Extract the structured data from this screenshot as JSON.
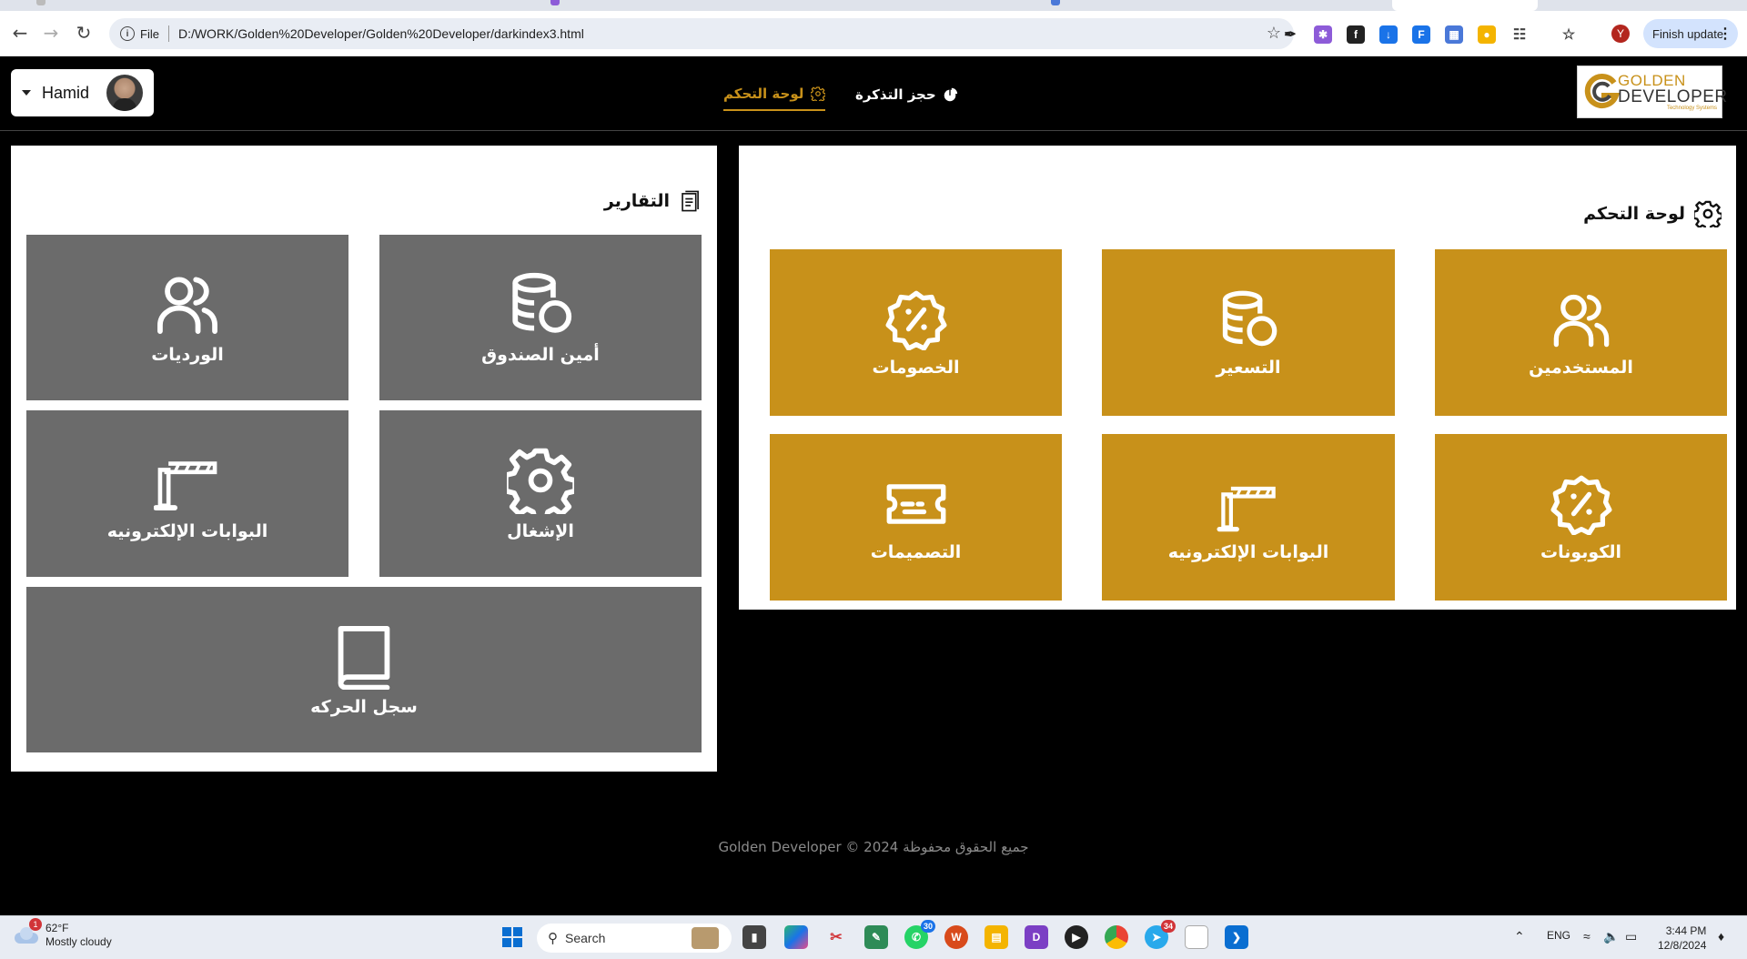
{
  "browser": {
    "address_scheme": "File",
    "address_url": "D:/WORK/Golden%20Developer/Golden%20Developer/darkindex3.html",
    "finish_update_label": "Finish update",
    "profile_initial": "Y"
  },
  "nav": {
    "user_name": "Hamid",
    "links": [
      {
        "label": "لوحة التحكم",
        "icon": "gear-icon",
        "active": true
      },
      {
        "label": "حجز التذكرة",
        "icon": "pie-icon",
        "active": false
      }
    ],
    "logo": {
      "line1": "GOLDEN",
      "line2": "DEVELOPER",
      "tagline": "Technology Systems"
    }
  },
  "dashboard_panel": {
    "title": "لوحة التحكم",
    "title_icon": "gear-icon",
    "tiles": [
      {
        "label": "المستخدمين",
        "icon": "users-icon"
      },
      {
        "label": "التسعير",
        "icon": "coins-icon"
      },
      {
        "label": "الخصومات",
        "icon": "discount-badge-icon"
      },
      {
        "label": "الكوبونات",
        "icon": "discount-badge-icon"
      },
      {
        "label": "البوابات الإلكترونيه",
        "icon": "barrier-gate-icon"
      },
      {
        "label": "التصميمات",
        "icon": "ticket-icon"
      }
    ],
    "accent": "#c8911a"
  },
  "reports_panel": {
    "title": "التقارير",
    "title_icon": "document-icon",
    "tiles": [
      {
        "label": "أمين الصندوق",
        "icon": "coins-icon"
      },
      {
        "label": "الورديات",
        "icon": "users-icon"
      },
      {
        "label": "الإشغال",
        "icon": "gear-icon"
      },
      {
        "label": "البوابات الإلكترونيه",
        "icon": "barrier-gate-icon"
      },
      {
        "label": "سجل الحركه",
        "icon": "book-icon"
      }
    ],
    "tile_color": "#6b6b6b"
  },
  "footer": {
    "text": "جميع الحقوق محفوظة Golden Developer © 2024"
  },
  "taskbar": {
    "weather_temp": "62°F",
    "weather_desc": "Mostly cloudy",
    "weather_badge": "1",
    "search_placeholder": "Search",
    "whatsapp_badge": "30",
    "telegram_badge": "34",
    "language": "ENG",
    "time": "3:44 PM",
    "date": "12/8/2024"
  }
}
